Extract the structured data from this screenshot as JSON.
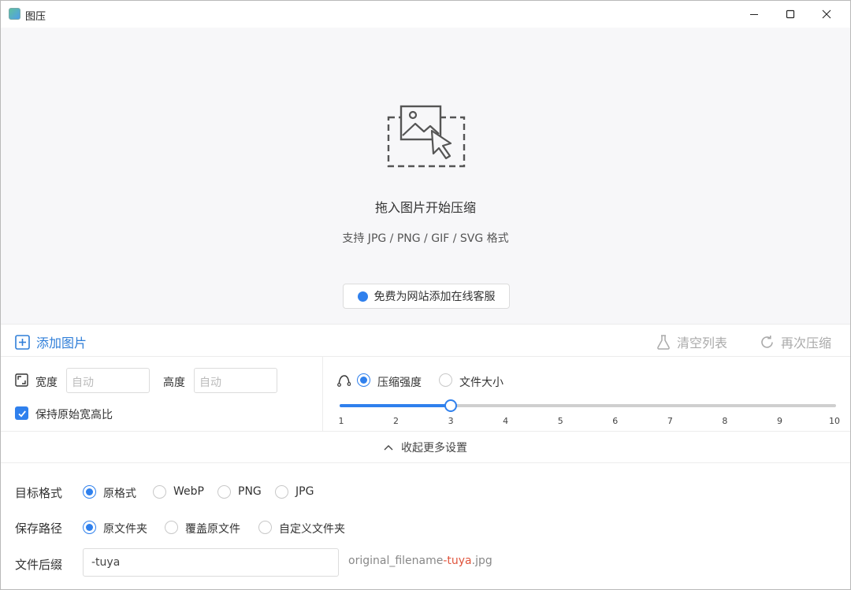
{
  "window": {
    "title": "图压",
    "controls": [
      "minimize",
      "maximize",
      "close"
    ]
  },
  "dropzone": {
    "icon": "image-drop-icon",
    "title": "拖入图片开始压缩",
    "subtitle": "支持 JPG / PNG / GIF / SVG 格式",
    "promo_label": "免费为网站添加在线客服"
  },
  "toolbar": {
    "add_label": "添加图片",
    "clear_label": "清空列表",
    "recompress_label": "再次压缩"
  },
  "size": {
    "width_label": "宽度",
    "width_placeholder": "自动",
    "height_label": "高度",
    "height_placeholder": "自动",
    "keep_ratio_label": "保持原始宽高比",
    "keep_ratio_checked": true
  },
  "compression": {
    "mode_strength_label": "压缩强度",
    "mode_filesize_label": "文件大小",
    "selected_mode": "压缩强度",
    "slider_min": 1,
    "slider_max": 10,
    "slider_value": 3,
    "ticks": [
      "1",
      "2",
      "3",
      "4",
      "5",
      "6",
      "7",
      "8",
      "9",
      "10"
    ]
  },
  "collapse_label": "收起更多设置",
  "target_format": {
    "label": "目标格式",
    "options": [
      "原格式",
      "WebP",
      "PNG",
      "JPG"
    ],
    "selected": "原格式"
  },
  "save_path": {
    "label": "保存路径",
    "options": [
      "原文件夹",
      "覆盖原文件",
      "自定义文件夹"
    ],
    "selected": "原文件夹"
  },
  "suffix": {
    "label": "文件后缀",
    "value": "-tuya",
    "preview_prefix": "original_filename",
    "preview_suffix": "-tuya",
    "preview_ext": ".jpg"
  },
  "colors": {
    "accent": "#2f80ed",
    "link": "#2f7ed8",
    "suffix_highlight": "#e0543c",
    "disabled": "#aaaaaa"
  }
}
